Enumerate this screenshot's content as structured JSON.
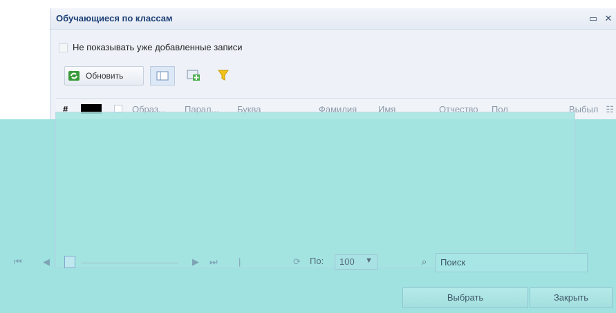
{
  "window": {
    "title": "Обучающиеся по классам",
    "maximize_icon": "maximize-icon",
    "close_icon": "close-icon"
  },
  "filter": {
    "checkbox_label": "Не показывать уже добавленные записи"
  },
  "toolbar": {
    "refresh_label": "Обновить"
  },
  "grid": {
    "columns": [
      "#",
      "Образ...",
      "Парал...",
      "Буква",
      "Фамилия",
      "Имя",
      "Отчество",
      "Пол",
      "Выбыл"
    ]
  },
  "pager": {
    "per_page_label": "По:",
    "per_page_value": "100",
    "search_label": "Поиск"
  },
  "footer": {
    "select_label": "Выбрать",
    "close_label": "Закрыть"
  },
  "colors": {
    "title": "#1c3f75",
    "overlay": "#9fe2e0"
  }
}
